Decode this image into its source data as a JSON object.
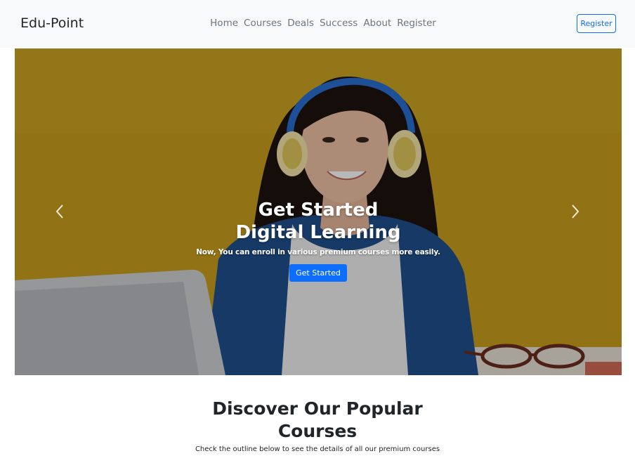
{
  "navbar": {
    "brand": "Edu-Point",
    "links": [
      "Home",
      "Courses",
      "Deals",
      "Success",
      "About",
      "Register"
    ],
    "register_button": "Register"
  },
  "hero": {
    "title": "Get Started Digital Learning",
    "subtitle": "Now, You can enroll in various premium courses more easily.",
    "cta_label": "Get Started",
    "prev_icon": "chevron-left-icon",
    "next_icon": "chevron-right-icon",
    "background_color": "#c49a1c"
  },
  "courses_section": {
    "title": "Discover Our Popular Courses",
    "subtitle": "Check the outline below to see the details of all our premium courses"
  },
  "colors": {
    "primary": "#0d6efd",
    "navbar_bg": "#f8f9fa",
    "nav_text": "#6c757d"
  }
}
